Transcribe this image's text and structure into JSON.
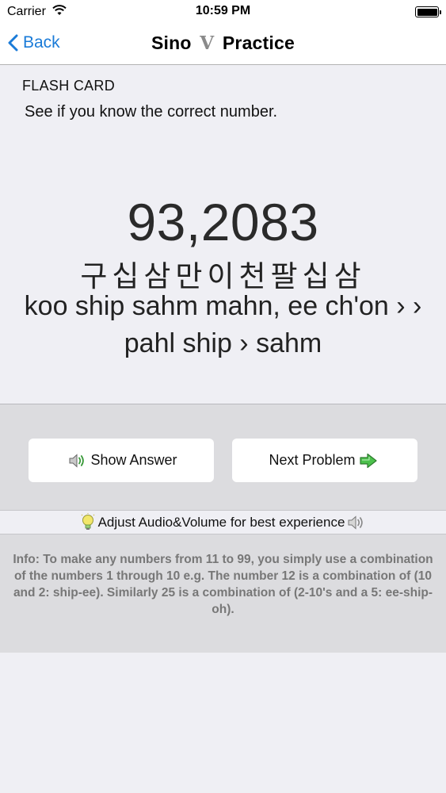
{
  "status_bar": {
    "carrier": "Carrier",
    "time": "10:59 PM"
  },
  "nav": {
    "back_label": "Back",
    "title_left": "Sino",
    "title_mark": "V",
    "title_right": "Practice"
  },
  "card": {
    "type_label": "FLASH CARD",
    "instruction": "See if you know the correct number.",
    "number": "93,2083",
    "korean": "구십삼만이천팔십삼",
    "romanization_line1": "koo ship sahm mahn, ee ch'on › ›",
    "romanization_line2": "pahl ship › sahm"
  },
  "buttons": {
    "show_answer": "Show Answer",
    "next_problem": "Next Problem"
  },
  "tip": {
    "text": "Adjust Audio&Volume for best experience"
  },
  "info": {
    "text": "Info: To make any numbers from 11 to 99, you simply use a combination of the numbers 1 through 10 e.g. The number 12 is a combination of (10 and 2: ship-ee). Similarly 25 is a combination of (2-10's and a 5: ee-ship-oh)."
  },
  "icons": {
    "back": "chevron-left-icon",
    "wifi": "wifi-icon",
    "battery": "battery-icon",
    "speaker": "speaker-icon",
    "next": "next-arrow-icon",
    "lightbulb": "lightbulb-icon"
  },
  "colors": {
    "accent": "#1a7bd8",
    "background": "#efeff4",
    "band": "#dcdcdf",
    "info_text": "#777777"
  }
}
